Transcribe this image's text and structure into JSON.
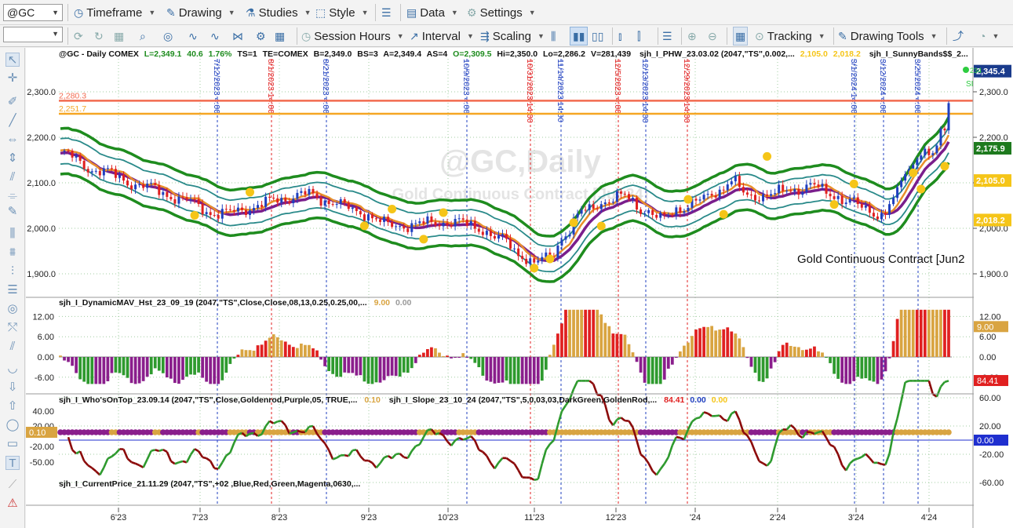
{
  "toolbar": {
    "symbol": "@GC",
    "timeframe": "Timeframe",
    "drawing": "Drawing",
    "studies": "Studies",
    "style": "Style",
    "data": "Data",
    "settings": "Settings",
    "session_hours": "Session Hours",
    "interval": "Interval",
    "scaling": "Scaling",
    "tracking": "Tracking",
    "drawing_tools": "Drawing Tools"
  },
  "chart": {
    "watermark_symbol": "@GC,Daily",
    "watermark_name": "Gold Continuous Contract [Jun24]",
    "description": "Gold Continuous Contract [Jun2",
    "header": {
      "symbol": "@GC - Daily  COMEX",
      "L": "L=2,349.1",
      "chg": "40.6",
      "pct": "1.76%",
      "ts": "TS=1",
      "te": "TE=COMEX",
      "B": "B=2,349.0",
      "BS": "BS=3",
      "A": "A=2,349.4",
      "AS": "AS=4",
      "O": "O=2,309.5",
      "Hi": "Hi=2,350.0",
      "Lo": "Lo=2,286.2",
      "V": "V=281,439",
      "study1": "sjh_I_PHW_23.03.02 (2047,\"TS\",0.002,...",
      "study1_v1": "2,105.0",
      "study1_v2": "2,018.2",
      "study2": "sjh_I_SunnyBands$$_2..."
    },
    "price_axis": [
      "2,300.0",
      "2,200.0",
      "2,100.0",
      "2,000.0",
      "1,900.0"
    ],
    "hlines": [
      {
        "label": "2,280.3",
        "value": 2280.3,
        "color": "#f26b4f"
      },
      {
        "label": "2,251.7",
        "value": 2251.7,
        "color": "#f5a623"
      }
    ],
    "price_tags": [
      {
        "label": "2,345.4",
        "value": 2345.4,
        "color": "#1a3b8c",
        "text": "#ffffff"
      },
      {
        "label": "2,175.9",
        "value": 2175.9,
        "color": "#1e7a1e",
        "text": "#ffffff"
      },
      {
        "label": "2,105.0",
        "value": 2105.0,
        "color": "#f5c518",
        "text": "#ffffff"
      },
      {
        "label": "2,018.2",
        "value": 2018.2,
        "color": "#f5c518",
        "text": "#ffffff"
      }
    ],
    "last_mark_label": "234",
    "last_mark_suffix": "SI",
    "vlines": [
      {
        "date": "7/12/2023",
        "time": "4:00",
        "color": "#1f3fbf"
      },
      {
        "date": "8/1/2023",
        "time": "14:00",
        "color": "#e02020"
      },
      {
        "date": "8/21/2023",
        "time": "4:00",
        "color": "#1f3fbf"
      },
      {
        "date": "10/9/2023",
        "time": "4:00",
        "color": "#1f3fbf"
      },
      {
        "date": "10/31/2023",
        "time": "14:00",
        "color": "#e02020"
      },
      {
        "date": "11/14/2023",
        "time": "14:00",
        "color": "#1f3fbf"
      },
      {
        "date": "12/5/2023",
        "time": "4:00",
        "color": "#e02020"
      },
      {
        "date": "12/13/2023",
        "time": "14:00",
        "color": "#1f3fbf"
      },
      {
        "date": "12/29/2023",
        "time": "14:00",
        "color": "#e02020"
      },
      {
        "date": "3/1/2024",
        "time": "14:00",
        "color": "#1f3fbf"
      },
      {
        "date": "3/12/2024",
        "time": "4:00",
        "color": "#1f3fbf"
      },
      {
        "date": "3/25/2024",
        "time": "4:00",
        "color": "#1f3fbf"
      }
    ],
    "x_axis": [
      "6'23",
      "7'23",
      "8'23",
      "9'23",
      "10'23",
      "11'23",
      "12'23",
      "'24",
      "2'24",
      "3'24",
      "4'24"
    ]
  },
  "pane2": {
    "label": "sjh_I_DynamicMAV_Hst_23_09_19 (2047,\"TS\",Close,Close,08,13,0.25,0.25,00,...",
    "v1": "9.00",
    "v2": "0.00",
    "axis": [
      "12.00",
      "6.00",
      "0.00",
      "-6.00"
    ],
    "tag": "9.00"
  },
  "pane3": {
    "label1": "sjh_I_Who'sOnTop_23.09.14 (2047,\"TS\",Close,Goldenrod,Purple,05,   TRUE,...",
    "label1_v": "0.10",
    "label2": "sjh_I_Slope_23_10_24 (2047,\"TS\",5,0,03,03,DarkGreen,GoldenRod,...",
    "label2_v1": "84.41",
    "label2_v2": "0.00",
    "label2_v3": "0.00",
    "label3": "sjh_I_CurrentPrice_21.11.29 (2047,\"TS\",+02 ,Blue,Red,Green,Magenta,0630,...",
    "left_axis": [
      "40.00",
      "20.00",
      "-20.00",
      "-50.00"
    ],
    "left_tag": "0.10",
    "right_axis": [
      "60.00",
      "20.00",
      "-20.00",
      "-60.00"
    ],
    "tag1": "84.41",
    "tag2": "0.00"
  },
  "colors": {
    "up": "#1f3fbf",
    "down": "#e02020",
    "band_outer": "#1e8c1e",
    "band_inner": "#2a8a8a",
    "mid_purple": "#7a1e8c",
    "mid_orange": "#e8902a",
    "dot": "#f5c518",
    "hist_gold": "#d9a441",
    "hist_red": "#e02020",
    "hist_green": "#2e9a2e",
    "hist_purple": "#8a1e8c",
    "slope_green": "#2e9a2e",
    "slope_red": "#8b0a0a",
    "wot_purple": "#8a1e8c",
    "wot_gold": "#d9a441"
  }
}
